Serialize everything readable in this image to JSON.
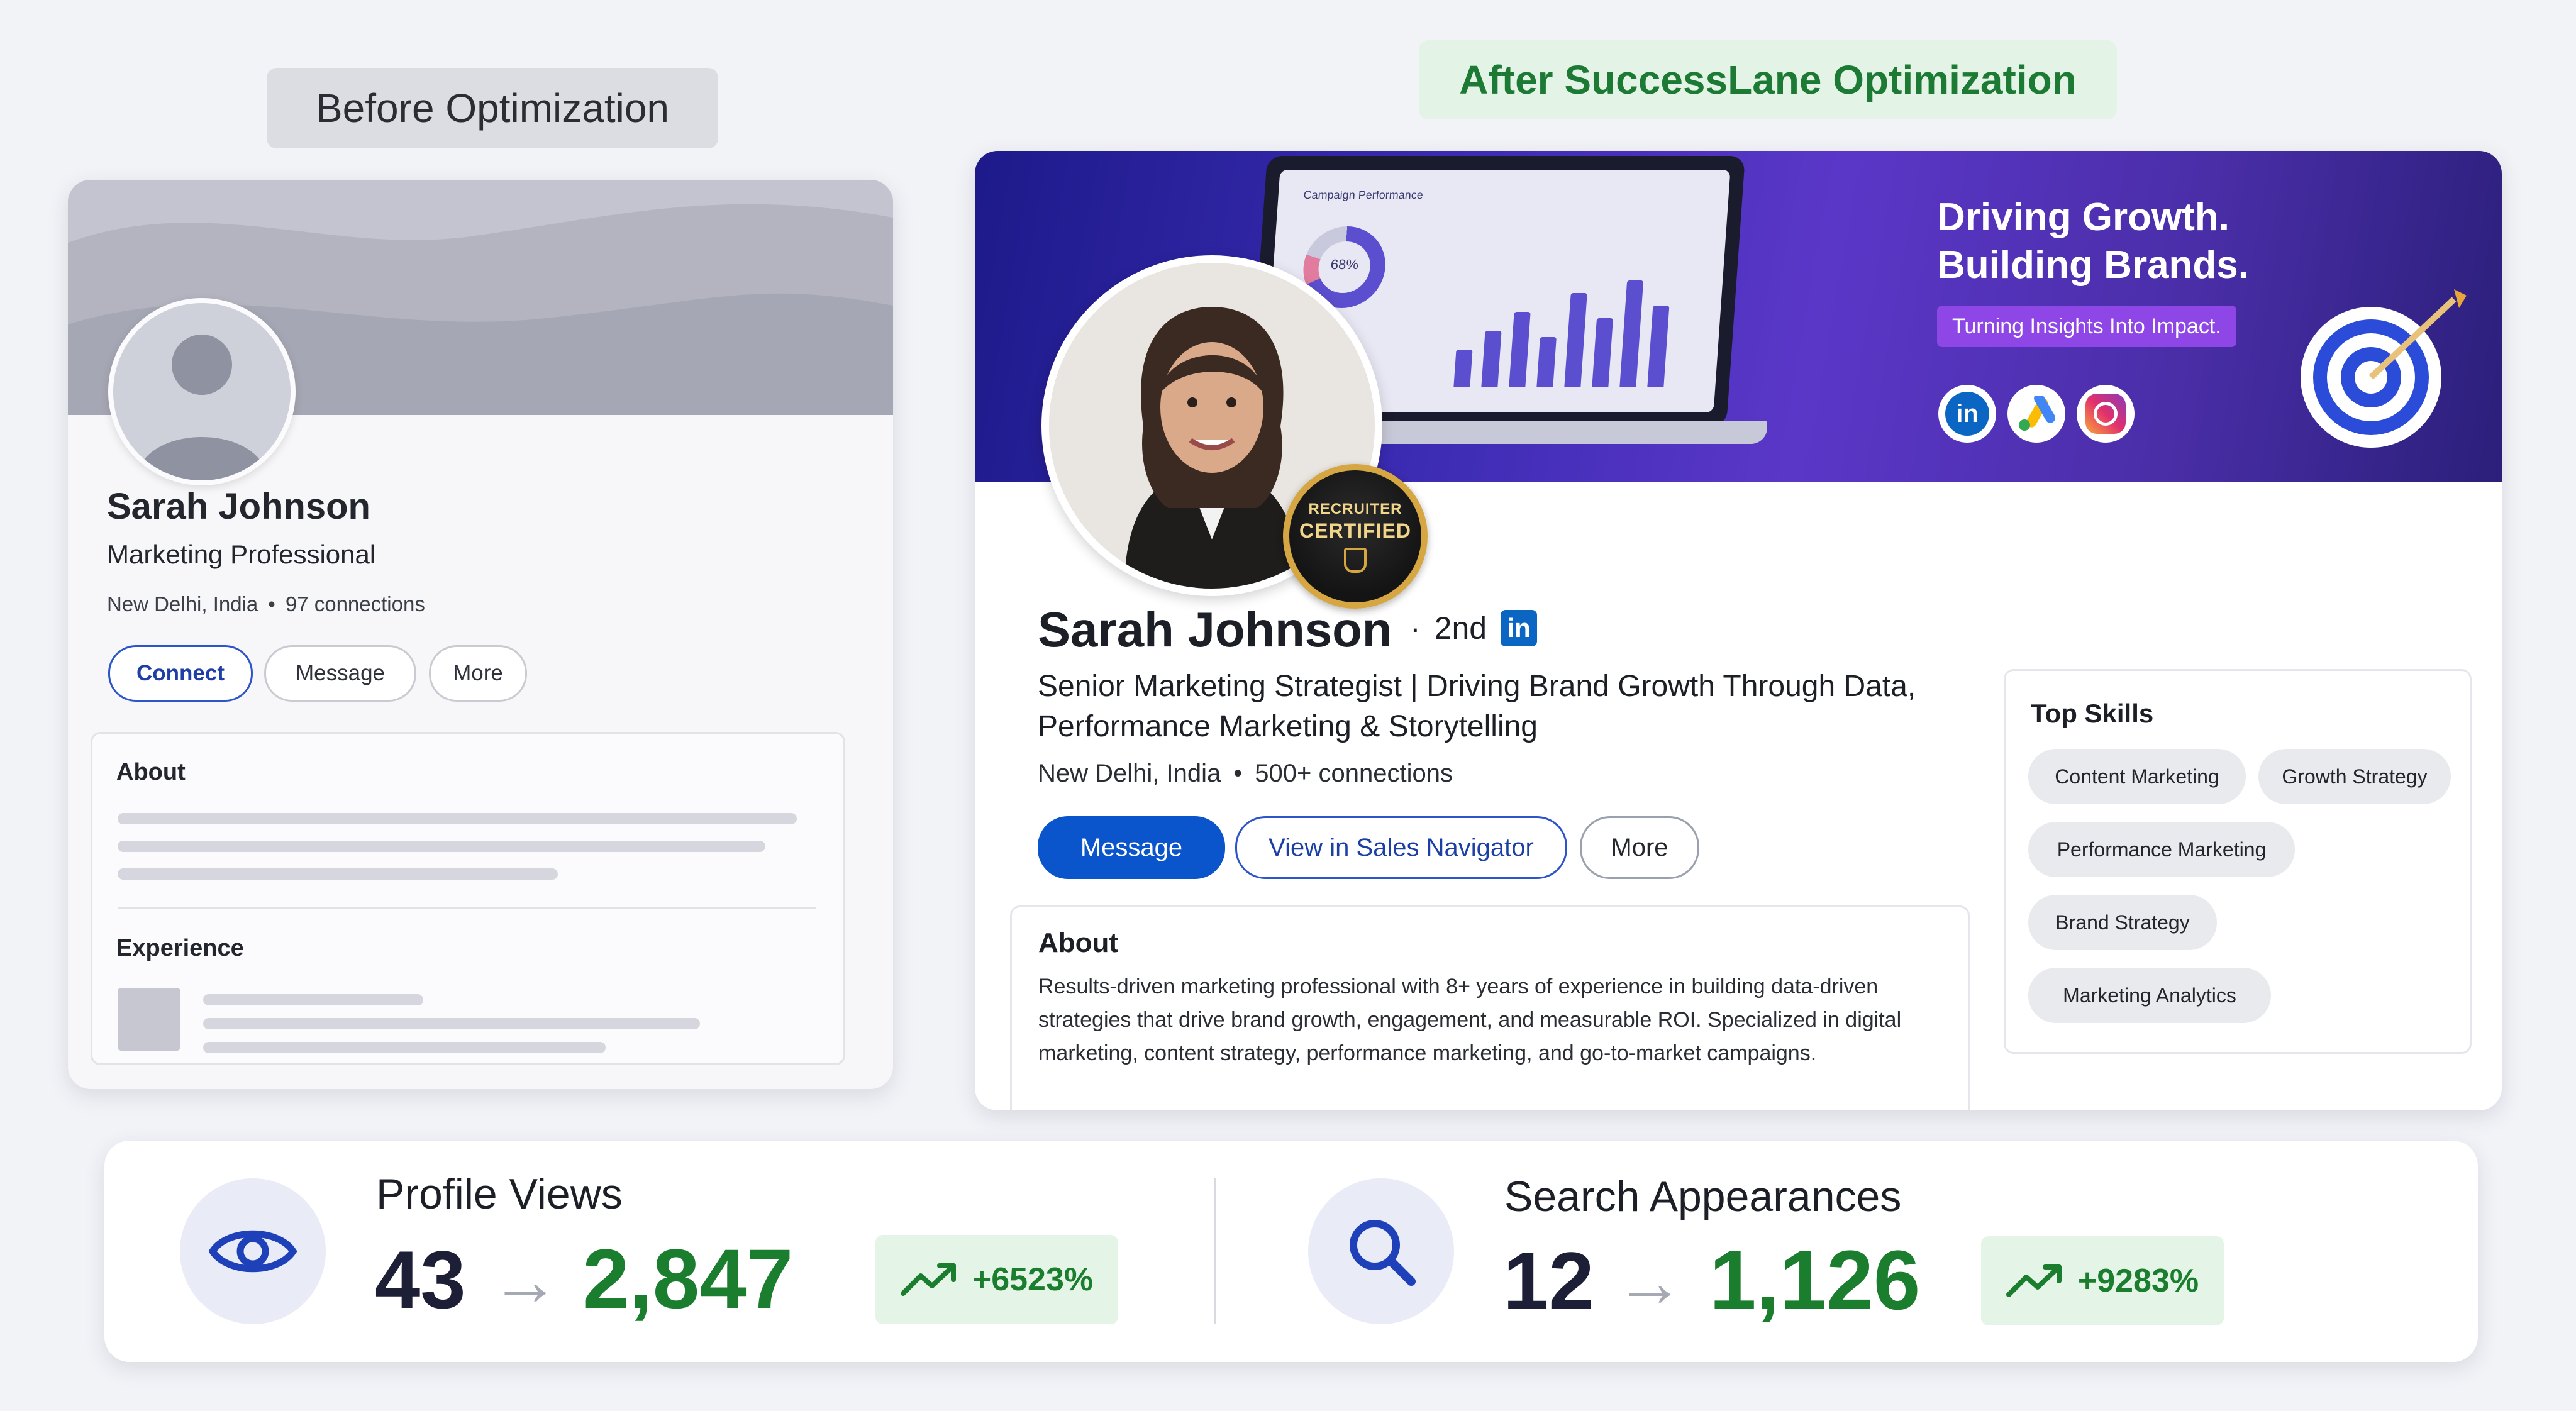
{
  "before": {
    "tag": "Before Optimization",
    "name": "Sarah Johnson",
    "headline": "Marketing Professional",
    "location": "New Delhi, India",
    "connections": "97 connections",
    "buttons": {
      "connect": "Connect",
      "message": "Message",
      "more": "More"
    },
    "about_title": "About",
    "experience_title": "Experience"
  },
  "after": {
    "tag": "After SuccessLane Optimization",
    "banner": {
      "line1": "Driving Growth.",
      "line2": "Building Brands.",
      "pill": "Turning Insights Into Impact.",
      "screen_title": "Campaign Performance",
      "donut_label": "68%",
      "social_icons": [
        "linkedin-icon",
        "google-ads-icon",
        "instagram-icon"
      ]
    },
    "badge": {
      "line1": "RECRUITER",
      "line2": "CERTIFIED"
    },
    "name": "Sarah Johnson",
    "degree": "2nd",
    "headline": "Senior Marketing Strategist | Driving Brand Growth Through Data, Performance Marketing & Storytelling",
    "location": "New Delhi, India",
    "connections": "500+ connections",
    "buttons": {
      "message": "Message",
      "sales_navigator": "View in Sales Navigator",
      "more": "More"
    },
    "about_title": "About",
    "about_text": "Results-driven marketing professional with 8+ years of experience in building data-driven strategies that drive brand growth, engagement, and measurable ROI. Specialized in digital marketing, content strategy, performance marketing, and go-to-market campaigns.",
    "skills_title": "Top Skills",
    "skills": [
      "Content Marketing",
      "Growth Strategy",
      "Performance Marketing",
      "Brand Strategy",
      "Marketing Analytics"
    ]
  },
  "stats": {
    "profile_views": {
      "label": "Profile Views",
      "before": "43",
      "after": "2,847",
      "change": "+6523%"
    },
    "search_appearances": {
      "label": "Search Appearances",
      "before": "12",
      "after": "1,126",
      "change": "+9283%"
    }
  },
  "colors": {
    "linkedin_blue": "#0a66c2",
    "growth_green": "#1b7d2e",
    "banner_purple": "#4a2ea8"
  }
}
